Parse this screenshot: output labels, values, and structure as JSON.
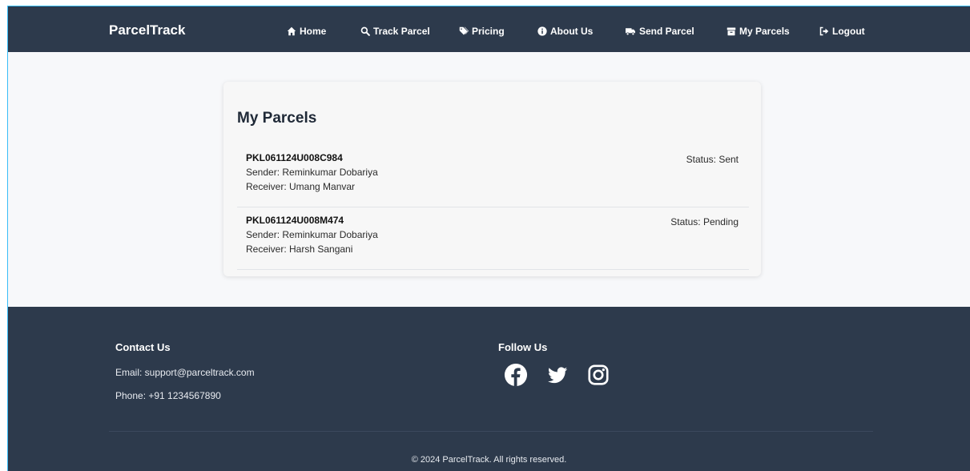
{
  "nav": {
    "brand": "ParcelTrack",
    "items": [
      {
        "label": "Home",
        "icon": "home-icon"
      },
      {
        "label": "Track Parcel",
        "icon": "search-icon"
      },
      {
        "label": "Pricing",
        "icon": "tags-icon"
      },
      {
        "label": "About Us",
        "icon": "info-icon"
      },
      {
        "label": "Send Parcel",
        "icon": "truck-icon"
      },
      {
        "label": "My Parcels",
        "icon": "box-icon"
      },
      {
        "label": "Logout",
        "icon": "logout-icon"
      }
    ]
  },
  "main": {
    "title": "My Parcels",
    "parcels": [
      {
        "id": "PKL061124U008C984",
        "sender": "Sender: Reminkumar Dobariya",
        "receiver": "Receiver: Umang Manvar",
        "status": "Status: Sent"
      },
      {
        "id": "PKL061124U008M474",
        "sender": "Sender: Reminkumar Dobariya",
        "receiver": "Receiver: Harsh Sangani",
        "status": "Status: Pending"
      }
    ]
  },
  "footer": {
    "contact_title": "Contact Us",
    "email": "Email: support@parceltrack.com",
    "phone": "Phone: +91 1234567890",
    "follow_title": "Follow Us",
    "social": [
      "facebook-icon",
      "twitter-icon",
      "instagram-icon"
    ],
    "copyright": "© 2024 ParcelTrack. All rights reserved."
  },
  "colors": {
    "navbar": "#2d3a4c",
    "footer": "#2d3a4c",
    "page_bg": "#f7f8fa"
  }
}
